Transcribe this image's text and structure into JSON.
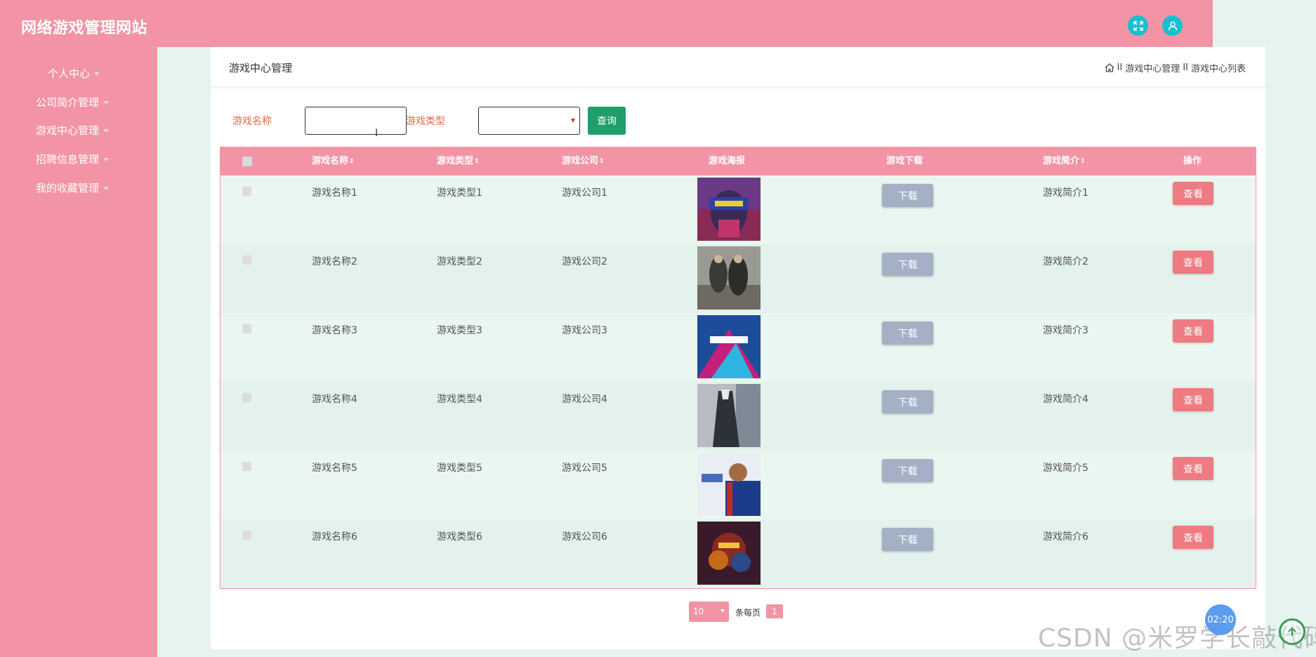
{
  "app": {
    "title": "网络游戏管理网站",
    "fullscreen_icon": "expand-icon",
    "user_icon": "user-icon",
    "accent_color": "#f294a5"
  },
  "sidebar": {
    "items": [
      {
        "label": "个人中心"
      },
      {
        "label": "公司简介管理"
      },
      {
        "label": "游戏中心管理"
      },
      {
        "label": "招聘信息管理"
      },
      {
        "label": "我的收藏管理"
      }
    ]
  },
  "page": {
    "title": "游戏中心管理",
    "breadcrumb": [
      "游戏中心管理",
      "游戏中心列表"
    ],
    "breadcrumb_separator": "II",
    "home_icon": "home-icon"
  },
  "search": {
    "name_label": "游戏名称",
    "name_value": "",
    "type_label": "游戏类型",
    "type_value": "",
    "query_label": "查询"
  },
  "table": {
    "columns": [
      "游戏名称",
      "游戏类型",
      "游戏公司",
      "游戏海报",
      "游戏下载",
      "游戏简介",
      "操作"
    ],
    "download_label": "下载",
    "view_label": "查看",
    "rows": [
      {
        "name": "游戏名称1",
        "type": "游戏类型1",
        "company": "游戏公司1",
        "intro": "游戏简介1"
      },
      {
        "name": "游戏名称2",
        "type": "游戏类型2",
        "company": "游戏公司2",
        "intro": "游戏简介2"
      },
      {
        "name": "游戏名称3",
        "type": "游戏类型3",
        "company": "游戏公司3",
        "intro": "游戏简介3"
      },
      {
        "name": "游戏名称4",
        "type": "游戏类型4",
        "company": "游戏公司4",
        "intro": "游戏简介4"
      },
      {
        "name": "游戏名称5",
        "type": "游戏类型5",
        "company": "游戏公司5",
        "intro": "游戏简介5"
      },
      {
        "name": "游戏名称6",
        "type": "游戏类型6",
        "company": "游戏公司6",
        "intro": "游戏简介6"
      }
    ]
  },
  "pagination": {
    "page_size": "10",
    "per_page_label": "条每页",
    "current_page": "1"
  },
  "overlay": {
    "timer": "02:20",
    "watermark": "CSDN @米罗学长敲代码"
  }
}
